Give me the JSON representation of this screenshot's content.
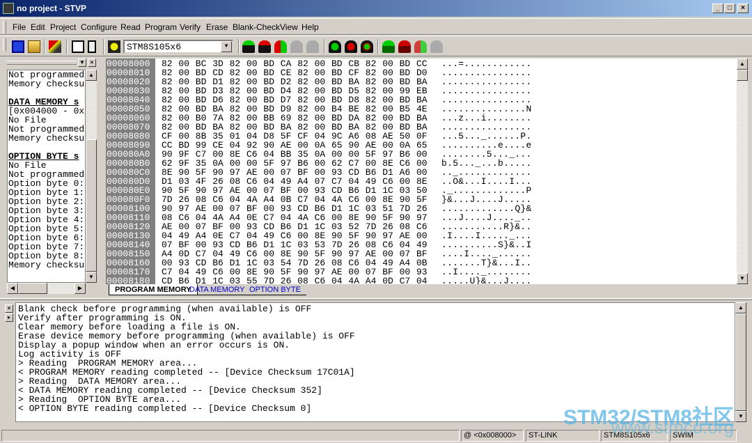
{
  "window": {
    "title": "no project - STVP",
    "controls": [
      "_",
      "□",
      "×"
    ]
  },
  "menu": [
    "File",
    "Edit",
    "Project",
    "Configure",
    "Read",
    "Program",
    "Verify",
    "Erase",
    "Blank-Check",
    "View",
    "Help"
  ],
  "toolbar": {
    "device": "STM8S105x6",
    "icons": [
      "save-icon",
      "open-icon",
      "program-project-icon",
      "copy-icon",
      "paste-icon",
      "configure-icon"
    ]
  },
  "left_panel": {
    "lines": [
      {
        "t": "Not programmed",
        "b": false
      },
      {
        "t": "Memory checksu",
        "b": false
      },
      {
        "t": "",
        "b": false
      },
      {
        "t": "DATA MEMORY s",
        "b": true
      },
      {
        "t": "[0x004000 - 0x",
        "b": false
      },
      {
        "t": "No File",
        "b": false
      },
      {
        "t": "Not programmed",
        "b": false
      },
      {
        "t": "Memory checksu",
        "b": false
      },
      {
        "t": "",
        "b": false
      },
      {
        "t": "OPTION BYTE s",
        "b": true
      },
      {
        "t": "No File",
        "b": false
      },
      {
        "t": "Not programmed",
        "b": false
      },
      {
        "t": "Option byte 0:",
        "b": false
      },
      {
        "t": "Option byte 1:",
        "b": false
      },
      {
        "t": "Option byte 2:",
        "b": false
      },
      {
        "t": "Option byte 3:",
        "b": false
      },
      {
        "t": "Option byte 4:",
        "b": false
      },
      {
        "t": "Option byte 5:",
        "b": false
      },
      {
        "t": "Option byte 6:",
        "b": false
      },
      {
        "t": "Option byte 7:",
        "b": false
      },
      {
        "t": "Option byte 8:",
        "b": false
      },
      {
        "t": "Memory checksu",
        "b": false
      }
    ]
  },
  "hex": {
    "rows": [
      {
        "a": "00008000",
        "h": "82 00 BC 3D 82 00 BD CA 82 00 BD CB 82 00 BD CC",
        "s": "...=............"
      },
      {
        "a": "00008010",
        "h": "82 00 BD CD 82 00 BD CE 82 00 BD CF 82 00 BD D0",
        "s": "................"
      },
      {
        "a": "00008020",
        "h": "82 00 BD D1 82 00 BD D2 82 00 BD BA 82 00 BD BA",
        "s": "................"
      },
      {
        "a": "00008030",
        "h": "82 00 BD D3 82 00 BD D4 82 00 BD D5 82 00 99 EB",
        "s": "................"
      },
      {
        "a": "00008040",
        "h": "82 00 BD D6 82 00 BD D7 82 00 BD D8 82 00 BD BA",
        "s": "................"
      },
      {
        "a": "00008050",
        "h": "82 00 BD BA 82 00 BD D9 82 00 B4 BE 82 00 B5 4E",
        "s": "...............N"
      },
      {
        "a": "00008060",
        "h": "82 00 B0 7A 82 00 BB 69 82 00 BD DA 82 00 BD BA",
        "s": "...z...i........"
      },
      {
        "a": "00008070",
        "h": "82 00 BD BA 82 00 BD BA 82 00 BD BA 82 00 BD BA",
        "s": "................"
      },
      {
        "a": "00008080",
        "h": "CF 00 8B 35 01 04 D8 5F CF 04 9C A6 08 AE 50 0F",
        "s": "...5..._......P."
      },
      {
        "a": "00008090",
        "h": "CC BD 99 CE 04 92 90 AE 00 0A 65 90 AE 00 0A 65",
        "s": "..........e....e"
      },
      {
        "a": "000080A0",
        "h": "90 9F C7 00 8E C6 04 BB 35 0A 00 00 5F 97 B6 00",
        "s": "........5..._..."
      },
      {
        "a": "000080B0",
        "h": "62 9F 35 0A 00 00 5F 97 B6 00 62 C7 00 8E C6 00",
        "s": "b.5..._...b....."
      },
      {
        "a": "000080C0",
        "h": "8E 90 5F 90 97 AE 00 07 BF 00 93 CD B6 D1 A6 00",
        "s": ".._............."
      },
      {
        "a": "000080D0",
        "h": "D1 03 4F 26 08 C6 04 49 A4 07 C7 04 49 C6 00 8E",
        "s": "..O&...I....I..."
      },
      {
        "a": "000080E0",
        "h": "90 5F 90 97 AE 00 07 BF 00 93 CD B6 D1 1C 03 50",
        "s": "._.............P"
      },
      {
        "a": "000080F0",
        "h": "7D 26 08 C6 04 4A A4 0B C7 04 4A C6 00 8E 90 5F",
        "s": "}&...J....J....."
      },
      {
        "a": "00008100",
        "h": "90 97 AE 00 07 BF 00 93 CD B6 D1 1C 03 51 7D 26",
        "s": ".............Q}&"
      },
      {
        "a": "00008110",
        "h": "08 C6 04 4A A4 0E C7 04 4A C6 00 8E 90 5F 90 97",
        "s": "...J....J...._.."
      },
      {
        "a": "00008120",
        "h": "AE 00 07 BF 00 93 CD B6 D1 1C 03 52 7D 26 08 C6",
        "s": "...........R}&.."
      },
      {
        "a": "00008130",
        "h": "04 49 A4 0E C7 04 49 C6 00 8E 90 5F 90 97 AE 00",
        "s": ".I....I....._..."
      },
      {
        "a": "00008140",
        "h": "07 BF 00 93 CD B6 D1 1C 03 53 7D 26 08 C6 04 49",
        "s": "..........S}&..I"
      },
      {
        "a": "00008150",
        "h": "A4 0D C7 04 49 C6 00 8E 90 5F 90 97 AE 00 07 BF",
        "s": "....I...._......"
      },
      {
        "a": "00008160",
        "h": "00 93 CD B6 D1 1C 03 54 7D 26 08 C6 04 49 A4 0B",
        "s": ".......T}&...I.."
      },
      {
        "a": "00008170",
        "h": "C7 04 49 C6 00 8E 90 5F 90 97 AE 00 07 BF 00 93",
        "s": "..I...._........"
      },
      {
        "a": "00008180",
        "h": "CD B6 D1 1C 03 55 7D 26 08 C6 04 4A A4 0D C7 04",
        "s": ".....U}&...J...."
      }
    ]
  },
  "tabs": [
    "PROGRAM MEMORY",
    "DATA MEMORY",
    "OPTION BYTE"
  ],
  "log": [
    "Blank check before programming (when available) is OFF",
    "Verify after programming is ON.",
    "Clear memory before loading a file is ON.",
    "Erase device memory before programming (when available) is OFF",
    "Display a popup window when an error occurs is ON.",
    "Log activity is OFF",
    "> Reading  PROGRAM MEMORY area...",
    "< PROGRAM MEMORY reading completed -- [Device Checksum 17C01A]",
    "> Reading  DATA MEMORY area...",
    "< DATA MEMORY reading completed -- [Device Checksum 352]",
    "> Reading  OPTION BYTE area...",
    "< OPTION BYTE reading completed -- [Device Checksum 0]"
  ],
  "status": {
    "address": "@ <0x008000>",
    "programmer": "ST-LINK",
    "device": "STM8S105x6",
    "protocol": "SWIM"
  },
  "watermark": {
    "line1": "STM32/STM8社区",
    "line2": "www.stmcu.org"
  },
  "colors": {
    "title_start": "#0a246a",
    "title_end": "#a6caf0",
    "address_bg": "#808080",
    "tab_link": "#0000cc"
  }
}
